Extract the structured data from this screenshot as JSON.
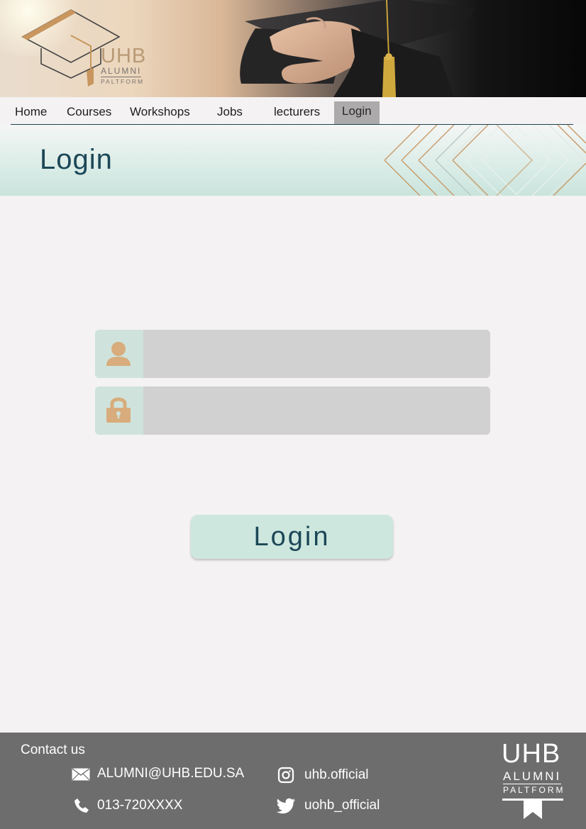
{
  "brand": {
    "name": "UHB",
    "line2": "ALUMNI",
    "line3": "PALTFORM"
  },
  "nav": {
    "items": [
      {
        "label": "Home"
      },
      {
        "label": "Courses"
      },
      {
        "label": "Workshops"
      },
      {
        "label": "Jobs"
      },
      {
        "label": "lecturers"
      },
      {
        "label": "Login"
      }
    ],
    "active": "Login"
  },
  "page": {
    "title": "Login"
  },
  "form": {
    "username": {
      "icon": "user-icon",
      "value": "",
      "placeholder": ""
    },
    "password": {
      "icon": "lock-icon",
      "value": "",
      "placeholder": ""
    },
    "submit_label": "Login"
  },
  "footer": {
    "title": "Contact us",
    "email": {
      "icon": "mail-icon",
      "text": "ALUMNI@UHB.EDU.SA"
    },
    "phone": {
      "icon": "phone-icon",
      "text": "013-720XXXX"
    },
    "instagram": {
      "icon": "instagram-icon",
      "text": "uhb.official"
    },
    "twitter": {
      "icon": "twitter-icon",
      "text": "uohb_official"
    }
  },
  "colors": {
    "accent_teal": "#cde7de",
    "title_navy": "#1c4757",
    "icon_gold": "#d8ac7c",
    "footer_gray": "#6d6d6d",
    "active_tab": "#acaaab"
  }
}
